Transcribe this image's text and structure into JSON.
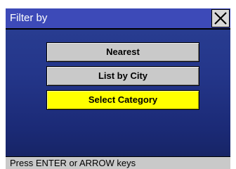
{
  "window": {
    "title": "Filter by"
  },
  "menu": {
    "items": [
      {
        "label": "Nearest",
        "selected": false
      },
      {
        "label": "List by City",
        "selected": false
      },
      {
        "label": "Select Category",
        "selected": true
      }
    ],
    "selected_color": "#ffff00",
    "normal_color": "#c9c9c9"
  },
  "status": {
    "text": "Press ENTER or ARROW keys"
  },
  "icons": {
    "close": "close-x-icon"
  }
}
